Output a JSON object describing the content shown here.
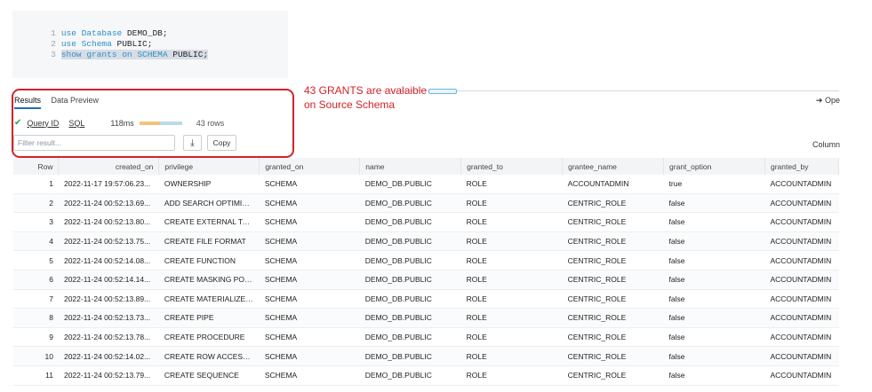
{
  "editor": {
    "lines": [
      {
        "num": "1",
        "kw": "use Database",
        "rest": " DEMO_DB;"
      },
      {
        "num": "2",
        "kw": "use Schema",
        "rest": " PUBLIC;"
      },
      {
        "num": "3",
        "kw": "show grants on SCHEMA",
        "rest": " PUBLIC;"
      }
    ]
  },
  "tabs": {
    "results": "Results",
    "preview": "Data Preview"
  },
  "open_label": "Ope",
  "columns_label": "Column",
  "status": {
    "query_id": "Query ID",
    "sql": "SQL",
    "duration": "118ms",
    "rows": "43 rows",
    "progress_fraction": 0.48
  },
  "filter": {
    "placeholder": "Filter result..."
  },
  "copy_label": "Copy",
  "annotation": "43 GRANTS are avalaible on Source Schema",
  "table": {
    "headers": [
      "Row",
      "created_on",
      "privilege",
      "granted_on",
      "name",
      "granted_to",
      "grantee_name",
      "grant_option",
      "granted_by"
    ],
    "rows": [
      [
        "1",
        "2022-11-17 19:57:06.23...",
        "OWNERSHIP",
        "SCHEMA",
        "DEMO_DB.PUBLIC",
        "ROLE",
        "ACCOUNTADMIN",
        "true",
        "ACCOUNTADMIN"
      ],
      [
        "2",
        "2022-11-24 00:52:13.69...",
        "ADD SEARCH OPTIMIZA...",
        "SCHEMA",
        "DEMO_DB.PUBLIC",
        "ROLE",
        "CENTRIC_ROLE",
        "false",
        "ACCOUNTADMIN"
      ],
      [
        "3",
        "2022-11-24 00:52:13.80...",
        "CREATE EXTERNAL TAB...",
        "SCHEMA",
        "DEMO_DB.PUBLIC",
        "ROLE",
        "CENTRIC_ROLE",
        "false",
        "ACCOUNTADMIN"
      ],
      [
        "4",
        "2022-11-24 00:52:13.75...",
        "CREATE FILE FORMAT",
        "SCHEMA",
        "DEMO_DB.PUBLIC",
        "ROLE",
        "CENTRIC_ROLE",
        "false",
        "ACCOUNTADMIN"
      ],
      [
        "5",
        "2022-11-24 00:52:14.08...",
        "CREATE FUNCTION",
        "SCHEMA",
        "DEMO_DB.PUBLIC",
        "ROLE",
        "CENTRIC_ROLE",
        "false",
        "ACCOUNTADMIN"
      ],
      [
        "6",
        "2022-11-24 00:52:14.14...",
        "CREATE MASKING POLI...",
        "SCHEMA",
        "DEMO_DB.PUBLIC",
        "ROLE",
        "CENTRIC_ROLE",
        "false",
        "ACCOUNTADMIN"
      ],
      [
        "7",
        "2022-11-24 00:52:13.89...",
        "CREATE MATERIALIZED ...",
        "SCHEMA",
        "DEMO_DB.PUBLIC",
        "ROLE",
        "CENTRIC_ROLE",
        "false",
        "ACCOUNTADMIN"
      ],
      [
        "8",
        "2022-11-24 00:52:13.73...",
        "CREATE PIPE",
        "SCHEMA",
        "DEMO_DB.PUBLIC",
        "ROLE",
        "CENTRIC_ROLE",
        "false",
        "ACCOUNTADMIN"
      ],
      [
        "9",
        "2022-11-24 00:52:13.78...",
        "CREATE PROCEDURE",
        "SCHEMA",
        "DEMO_DB.PUBLIC",
        "ROLE",
        "CENTRIC_ROLE",
        "false",
        "ACCOUNTADMIN"
      ],
      [
        "10",
        "2022-11-24 00:52:14.02...",
        "CREATE ROW ACCESS ...",
        "SCHEMA",
        "DEMO_DB.PUBLIC",
        "ROLE",
        "CENTRIC_ROLE",
        "false",
        "ACCOUNTADMIN"
      ],
      [
        "11",
        "2022-11-24 00:52:13.79...",
        "CREATE SEQUENCE",
        "SCHEMA",
        "DEMO_DB.PUBLIC",
        "ROLE",
        "CENTRIC_ROLE",
        "false",
        "ACCOUNTADMIN"
      ]
    ]
  }
}
